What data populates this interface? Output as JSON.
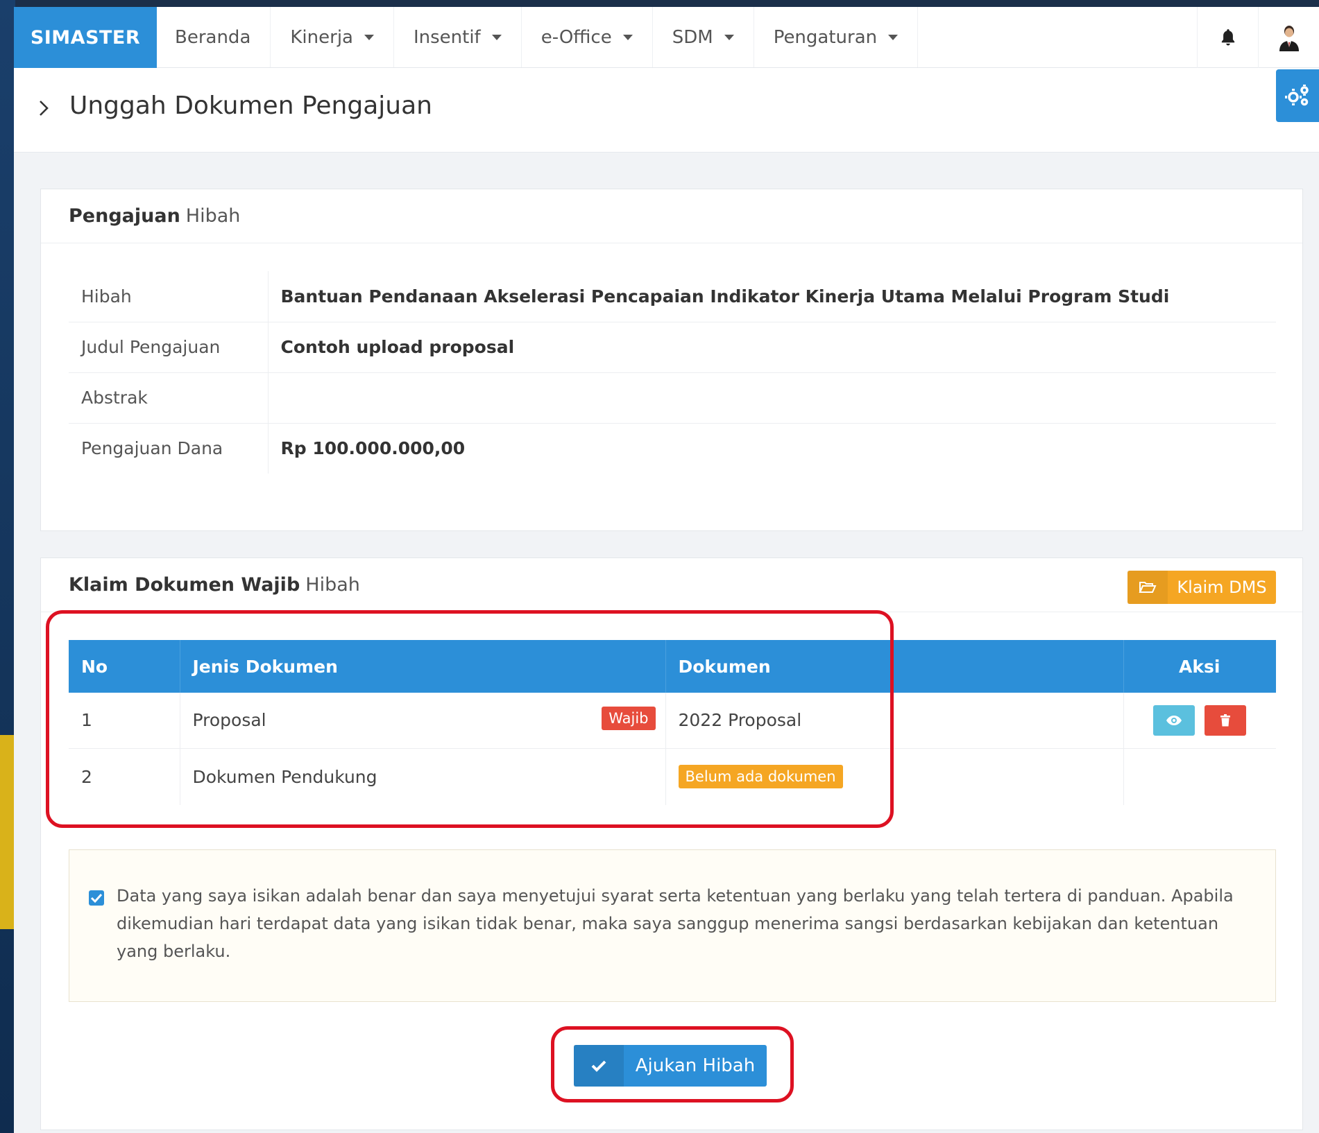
{
  "navbar": {
    "brand": "SIMASTER",
    "items": [
      {
        "label": "Beranda",
        "has_caret": false
      },
      {
        "label": "Kinerja",
        "has_caret": true
      },
      {
        "label": "Insentif",
        "has_caret": true
      },
      {
        "label": "e-Office",
        "has_caret": true
      },
      {
        "label": "SDM",
        "has_caret": true
      },
      {
        "label": "Pengaturan",
        "has_caret": true
      }
    ],
    "icons": [
      "bell-icon",
      "user-avatar-icon"
    ]
  },
  "page": {
    "title": "Unggah Dokumen Pengajuan"
  },
  "pengajuan_card": {
    "title_bold": "Pengajuan",
    "title_light": "Hibah",
    "rows": [
      {
        "key": "Hibah",
        "value": "Bantuan Pendanaan Akselerasi Pencapaian Indikator Kinerja Utama Melalui Program Studi"
      },
      {
        "key": "Judul Pengajuan",
        "value": "Contoh upload proposal"
      },
      {
        "key": "Abstrak",
        "value": ""
      },
      {
        "key": "Pengajuan Dana",
        "value": "Rp 100.000.000,00"
      }
    ]
  },
  "klaim_card": {
    "title_bold": "Klaim Dokumen Wajib",
    "title_light": "Hibah",
    "klaim_button": "Klaim DMS",
    "columns": [
      "No",
      "Jenis Dokumen",
      "Dokumen",
      "Aksi"
    ],
    "rows": [
      {
        "no": "1",
        "jenis": "Proposal",
        "badge": "Wajib",
        "dokumen": "2022 Proposal"
      },
      {
        "no": "2",
        "jenis": "Dokumen Pendukung",
        "status": "Belum ada dokumen"
      }
    ],
    "agreement": {
      "checked": true,
      "text": "Data yang saya isikan adalah benar dan saya menyetujui syarat serta ketentuan yang berlaku yang telah tertera di panduan. Apabila dikemudian hari terdapat data yang isikan tidak benar, maka saya sanggup menerima sangsi berdasarkan kebijakan dan ketentuan yang berlaku."
    },
    "submit_button": "Ajukan Hibah"
  },
  "colors": {
    "primary": "#2c8fd8",
    "warning": "#f5a623",
    "danger": "#e74c3c",
    "info": "#5bc0de",
    "highlight": "#dd1122"
  }
}
